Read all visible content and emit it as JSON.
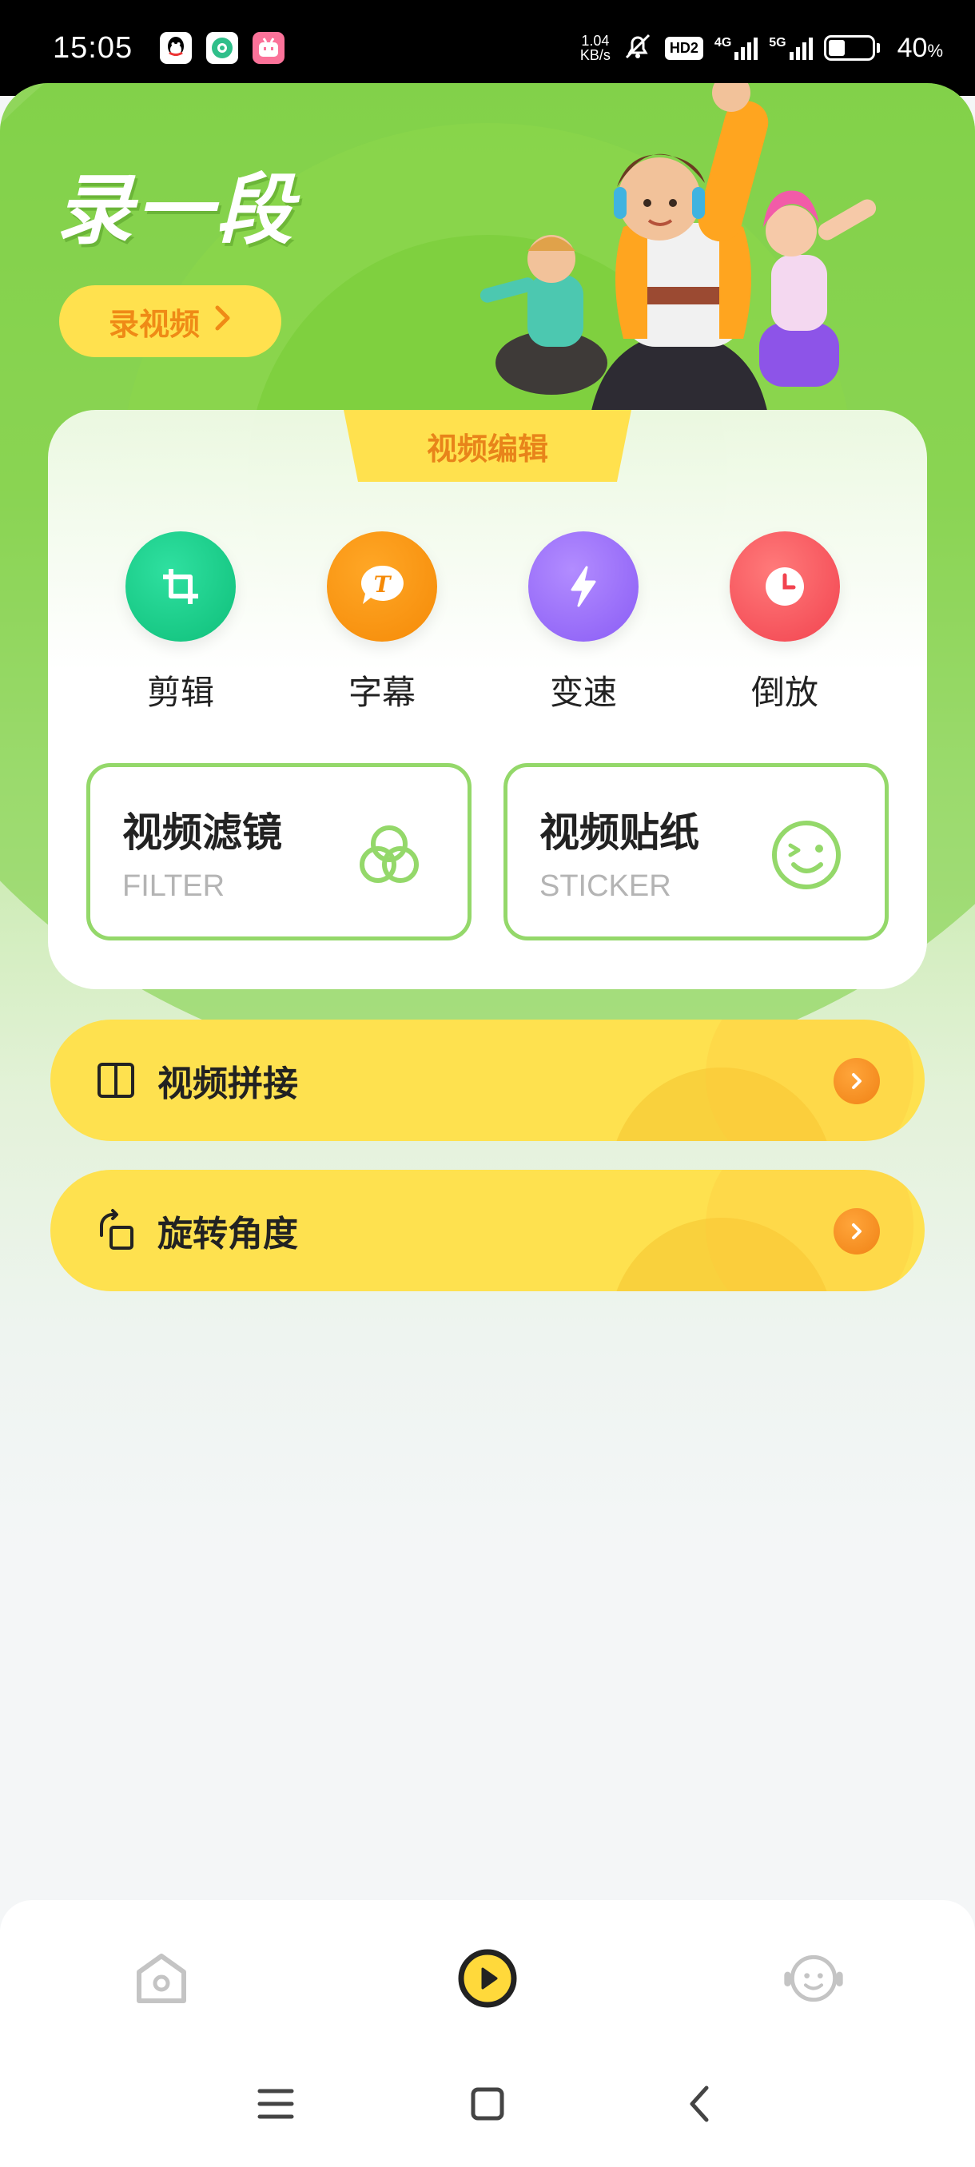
{
  "status_bar": {
    "time": "15:05",
    "speed_value": "1.04",
    "speed_unit": "KB/s",
    "hd_label": "HD2",
    "net1_label": "4G",
    "net2_label": "5G",
    "battery_percent": "40",
    "battery_symbol": "%",
    "battery_level": 0.4,
    "apps": [
      "qq-icon",
      "browser-icon",
      "bilibili-icon"
    ]
  },
  "hero": {
    "title": "录一段",
    "record_button_label": "录视频"
  },
  "edit_section": {
    "tab_label": "视频编辑",
    "tools": [
      {
        "label": "剪辑",
        "icon": "crop-icon",
        "color": "#12c983"
      },
      {
        "label": "字幕",
        "icon": "subtitle-icon",
        "color": "#f9940f"
      },
      {
        "label": "变速",
        "icon": "speed-icon",
        "color": "#9b6ef8"
      },
      {
        "label": "倒放",
        "icon": "clock-icon",
        "color": "#f65459"
      }
    ],
    "cards": [
      {
        "title": "视频滤镜",
        "subtitle": "FILTER",
        "icon": "filter-icon"
      },
      {
        "title": "视频贴纸",
        "subtitle": "STICKER",
        "icon": "sticker-icon"
      }
    ]
  },
  "list_items": [
    {
      "label": "视频拼接",
      "icon": "splice-icon"
    },
    {
      "label": "旋转角度",
      "icon": "rotate-icon"
    }
  ],
  "bottom_nav": {
    "items": [
      "home-icon",
      "play-icon",
      "face-icon"
    ],
    "active_color": "#222222",
    "inactive_color": "#c4c4c4"
  },
  "colors": {
    "accent_yellow": "#fee14f",
    "accent_orange": "#ef8a16",
    "green": "#94d86a"
  }
}
